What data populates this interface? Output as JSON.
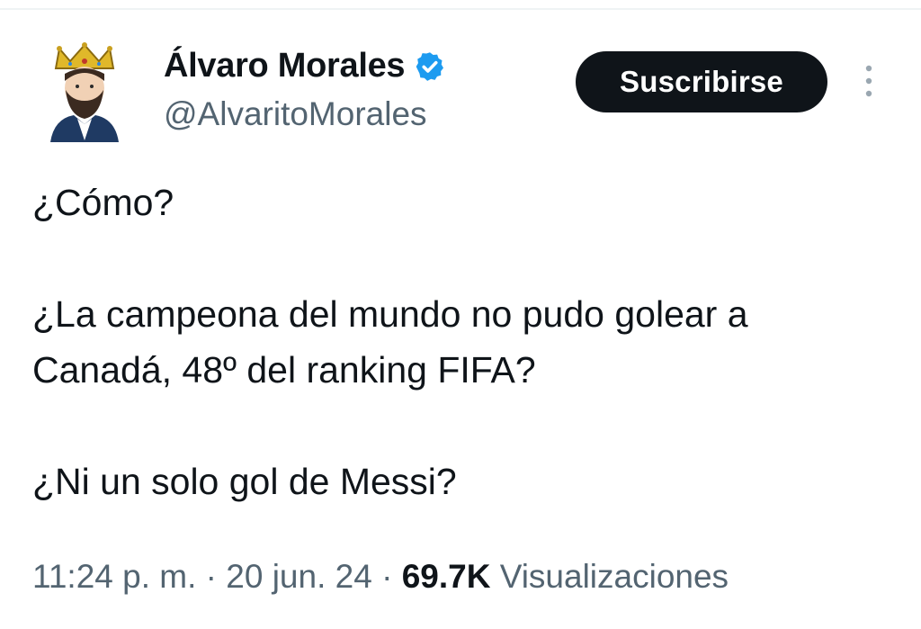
{
  "colors": {
    "text_primary": "#0f1419",
    "text_secondary": "#536471",
    "verified_blue": "#1d9bf0",
    "button_bg": "#0f1419",
    "button_text": "#ffffff"
  },
  "author": {
    "display_name": "Álvaro Morales",
    "handle": "@AlvaritoMorales",
    "verified_icon": "verified-badge-icon",
    "avatar_icon": "crowned-bearded-man-avatar"
  },
  "actions": {
    "subscribe_label": "Suscribirse",
    "more_icon": "vertical-ellipsis-icon"
  },
  "tweet": {
    "paragraphs": [
      "¿Cómo?",
      "¿La campeona del mundo no pudo golear a Canadá, 48º del ranking FIFA?",
      "¿Ni un solo gol de Messi?"
    ]
  },
  "meta": {
    "time": "11:24 p. m.",
    "separator": "·",
    "date": "20 jun. 24",
    "views_count": "69.7K",
    "views_label": "Visualizaciones"
  }
}
